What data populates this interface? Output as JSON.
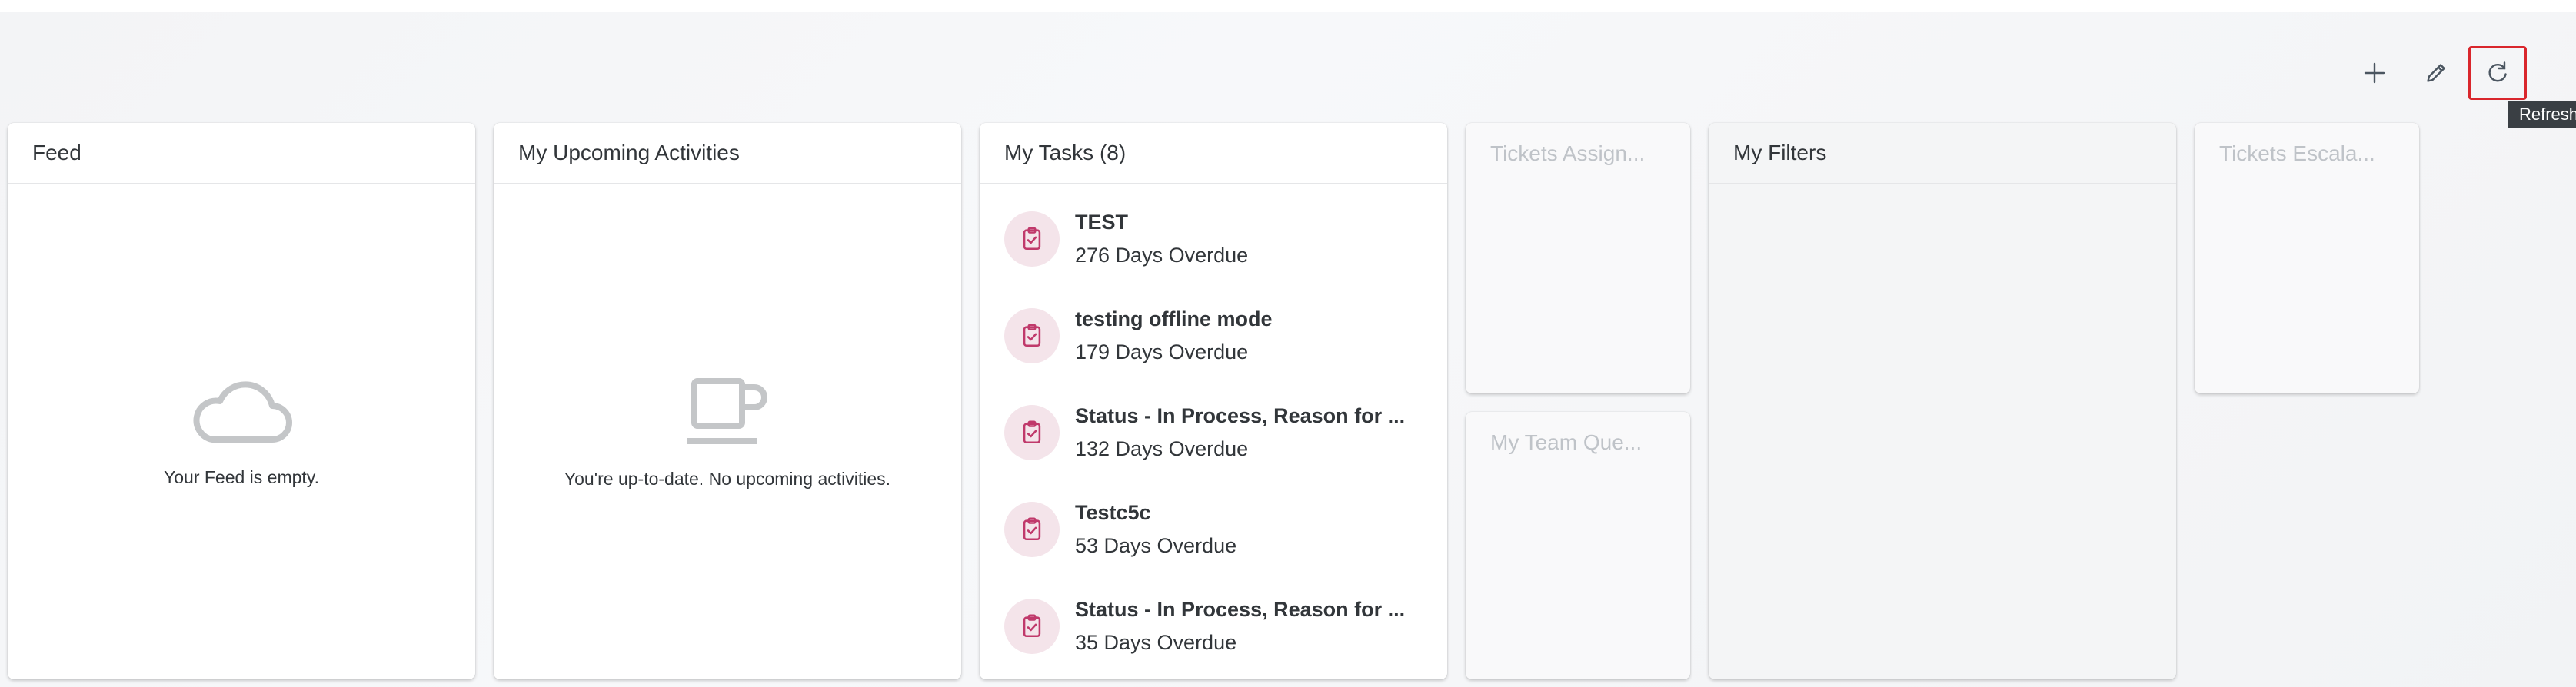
{
  "toolbar": {
    "add_icon": "plus-icon",
    "edit_icon": "pencil-icon",
    "refresh_icon": "refresh-icon",
    "tooltip": "Refresh"
  },
  "cards": {
    "feed": {
      "title": "Feed",
      "empty_text": "Your Feed is empty.",
      "icon": "cloud-icon"
    },
    "activities": {
      "title": "My Upcoming Activities",
      "empty_text": "You're up-to-date. No upcoming activities.",
      "icon": "coffee-cup-icon"
    },
    "tasks": {
      "title": "My Tasks (8)",
      "items": [
        {
          "title": "TEST",
          "sub": "276 Days Overdue"
        },
        {
          "title": "testing offline mode",
          "sub": "179 Days Overdue"
        },
        {
          "title": "Status - In Process, Reason for ...",
          "sub": "132 Days Overdue"
        },
        {
          "title": "Testc5c",
          "sub": "53 Days Overdue"
        },
        {
          "title": "Status - In Process, Reason for ...",
          "sub": "35 Days Overdue"
        }
      ]
    },
    "tickets_assigned": {
      "title": "Tickets Assign..."
    },
    "team_queue": {
      "title": "My Team Que..."
    },
    "filters": {
      "title": "My Filters"
    },
    "tickets_escalated": {
      "title": "Tickets Escala..."
    }
  },
  "colors": {
    "accent_red": "#d9262c",
    "task_icon": "#c0396b",
    "task_icon_bg": "#f4e4ea"
  }
}
